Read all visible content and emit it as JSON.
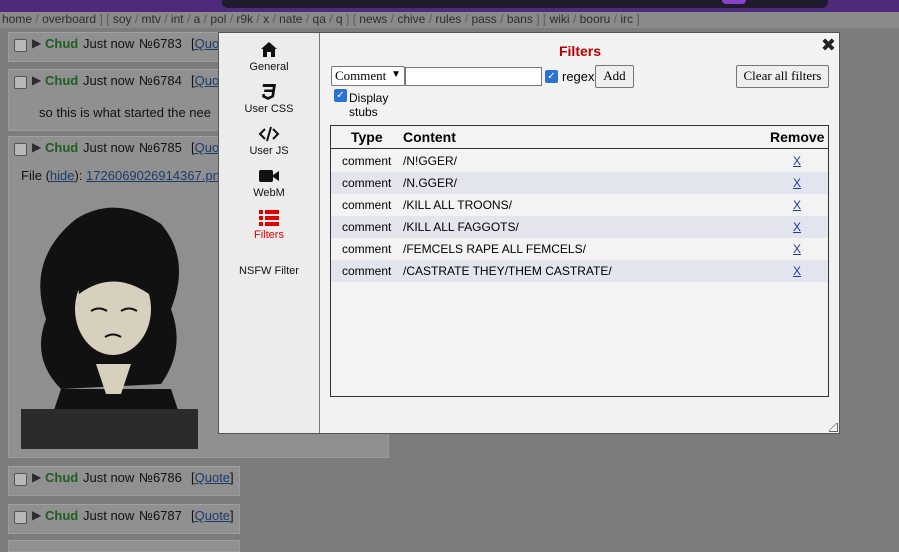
{
  "nav": {
    "groups": [
      [
        "home",
        "overboard"
      ],
      [
        "soy",
        "mtv",
        "int",
        "a",
        "pol",
        "r9k",
        "x",
        "nate",
        "qa",
        "q"
      ],
      [
        "news",
        "chive",
        "rules",
        "pass",
        "bans"
      ],
      [
        "wiki",
        "booru",
        "irc"
      ]
    ]
  },
  "posts": [
    {
      "name": "Chud",
      "time": "Just now",
      "num": "№6783",
      "quote": "Quo"
    },
    {
      "name": "Chud",
      "time": "Just now",
      "num": "№6784",
      "quote": "Quo",
      "body": "so this is what started the nee"
    },
    {
      "name": "Chud",
      "time": "Just now",
      "num": "№6785",
      "quote": "Quo",
      "file_label": "File",
      "hide": "hide",
      "filename": "1726069026914367.pn"
    },
    {
      "name": "Chud",
      "time": "Just now",
      "num": "№6786",
      "quote": "Quote"
    },
    {
      "name": "Chud",
      "time": "Just now",
      "num": "№6787",
      "quote": "Quote"
    }
  ],
  "dialog": {
    "title": "Filters",
    "tabs": [
      {
        "label": "General",
        "icon": "home-icon"
      },
      {
        "label": "User CSS",
        "icon": "css3-icon"
      },
      {
        "label": "User JS",
        "icon": "code-icon"
      },
      {
        "label": "WebM",
        "icon": "video-icon"
      },
      {
        "label": "Filters",
        "icon": "list-icon",
        "active": true
      },
      {
        "label": "NSFW Filter",
        "icon": ""
      }
    ],
    "filter_type": "Comment",
    "filter_text": "",
    "regex_label": "regex",
    "regex_checked": true,
    "add_label": "Add",
    "clear_label": "Clear all filters",
    "stubs_label": "Display stubs",
    "stubs_checked": true,
    "table": {
      "headers": [
        "Type",
        "Content",
        "Remove"
      ],
      "rows": [
        {
          "type": "comment",
          "content": "/N!GGER/",
          "remove": "X"
        },
        {
          "type": "comment",
          "content": "/N.GGER/",
          "remove": "X"
        },
        {
          "type": "comment",
          "content": "/KILL ALL TROONS/",
          "remove": "X"
        },
        {
          "type": "comment",
          "content": "/KILL ALL FAGGOTS/",
          "remove": "X"
        },
        {
          "type": "comment",
          "content": "/FEMCELS RAPE ALL FEMCELS/",
          "remove": "X"
        },
        {
          "type": "comment",
          "content": "/CASTRATE THEY/THEM CASTRATE/",
          "remove": "X"
        }
      ]
    },
    "colors": {
      "accent": "#b80000",
      "active_tab": "#e00000",
      "checkbox": "#2a72d4"
    }
  }
}
